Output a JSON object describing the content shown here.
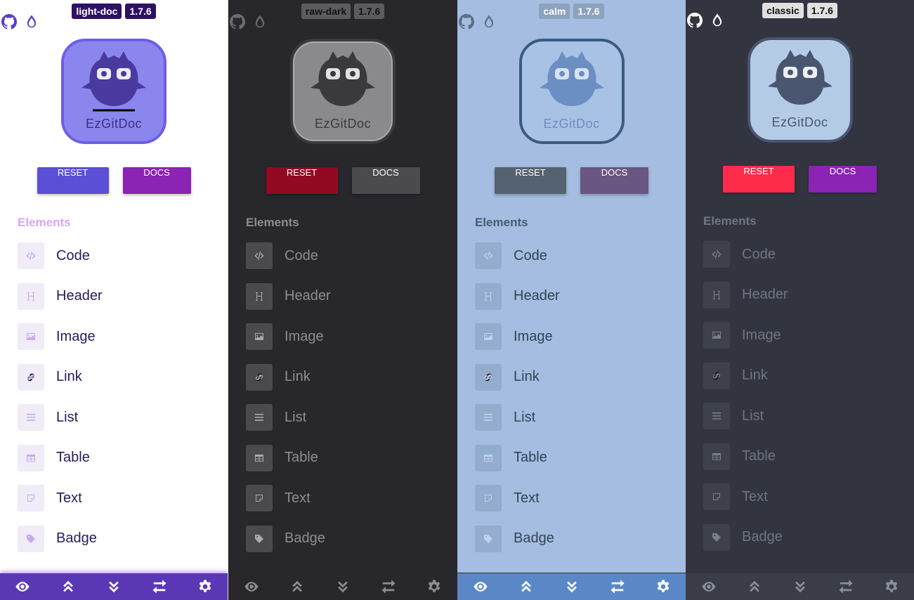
{
  "brand": "EzGitDoc",
  "version": "1.7.6",
  "reset_label": "RESET",
  "docs_label": "DOCS",
  "elements_title": "Elements",
  "elements": [
    {
      "label": "Code",
      "icon": "code-icon"
    },
    {
      "label": "Header",
      "icon": "header-icon"
    },
    {
      "label": "Image",
      "icon": "image-icon"
    },
    {
      "label": "Link",
      "icon": "link-icon"
    },
    {
      "label": "List",
      "icon": "list-icon"
    },
    {
      "label": "Table",
      "icon": "table-icon"
    },
    {
      "label": "Text",
      "icon": "text-icon"
    },
    {
      "label": "Badge",
      "icon": "badge-icon"
    }
  ],
  "themes": [
    {
      "name": "light-doc"
    },
    {
      "name": "raw-dark"
    },
    {
      "name": "calm"
    },
    {
      "name": "classic"
    }
  ],
  "bottom_bar": [
    "eye-icon",
    "chevrons-up-icon",
    "chevrons-down-icon",
    "swap-icon",
    "gear-icon"
  ]
}
